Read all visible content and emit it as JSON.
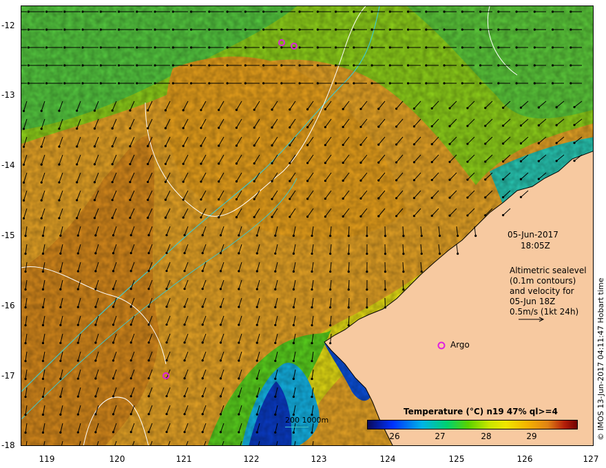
{
  "map": {
    "lat_ticks": [
      "-12",
      "-13",
      "-14",
      "-15",
      "-16",
      "-17",
      "-18"
    ],
    "lon_ticks": [
      "119",
      "120",
      "121",
      "122",
      "123",
      "124",
      "125",
      "126",
      "127"
    ],
    "lon_range": [
      118.6,
      127.0
    ],
    "lat_range": [
      -12.0,
      -18.0
    ]
  },
  "annotations": {
    "datetime_line1": "05-Jun-2017",
    "datetime_line2": "18:05Z",
    "altimetry_line1": "Altimetric sealevel",
    "altimetry_line2": "(0.1m contours)",
    "altimetry_line3": "and velocity for",
    "altimetry_line4": "05-Jun 18Z",
    "altimetry_line5": "0.5m/s (1kt 24h)",
    "argo_label": "Argo",
    "depth_legend": "200  1000m",
    "side_credit": "© IMOS 13-Jun-2017 04:11:47 Hobart time"
  },
  "colorbar": {
    "title": "Temperature (°C) n19 47% ql>=4",
    "ticks": [
      "26",
      "27",
      "28",
      "29"
    ],
    "colors": [
      "#0a0a5a",
      "#0032ff",
      "#00b4e6",
      "#00d26e",
      "#5ad200",
      "#c8e600",
      "#f0e600",
      "#f5b400",
      "#e08214",
      "#b41e0a",
      "#700000"
    ]
  },
  "colors": {
    "land": "#f7c9a0",
    "warm": "#e8a020",
    "contour_isobath": "#40c8c8",
    "contour_sealevel": "#ffffff",
    "argo_marker": "#e020e0"
  }
}
